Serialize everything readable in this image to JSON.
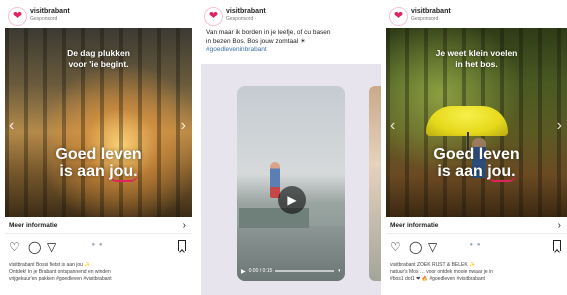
{
  "posts": [
    {
      "account": "visitbrabant",
      "subtitle": "Gesponsord",
      "overlay_top": "De dag plukken\nvoor 'ie begint.",
      "slogan_line1": "Goed leven",
      "slogan_line2_pre": "is aan ",
      "slogan_line2_em": "jou.",
      "more_info": "Meer informatie",
      "caption": "visitbrabant Bossi fietst is aan jou ✨\nOntdek! In je Brabant ontspannend en winden\nvrijgekuur'en pakken #goedleven #visitbrabant"
    },
    {
      "account": "visitbrabant",
      "subtitle": "Gesponsord ·",
      "text": "Van maar ik borden in je leefje, of cu basen\nin bezen Bos. Bos jouw zomtaal ☀",
      "hashtag": "#goedleveninbrabant",
      "video_time": "0:00 / 0:15"
    },
    {
      "account": "visitbrabant",
      "subtitle": "Gesponsord",
      "overlay_top": "Je weet klein voelen\nin het bos.",
      "slogan_line1": "Goed leven",
      "slogan_line2_pre": "is aan ",
      "slogan_line2_em": "jou.",
      "more_info": "Meer informatie",
      "caption": "visitbrabant ZOEK RUST & BELEK ✨\nnatuur's Mos … voor ontdek mooie nwaar je in\n#bos1 dot1 ❤ 🔥 #goedleven #visitbrabant"
    }
  ],
  "icons": {
    "heart": "heart-icon",
    "comment": "comment-icon",
    "share": "share-icon",
    "bookmark": "bookmark-icon",
    "chevron": "chevron-right-icon",
    "play": "play-icon"
  },
  "colors": {
    "brand": "#e0245e",
    "umbrella": "#f2e41f"
  }
}
